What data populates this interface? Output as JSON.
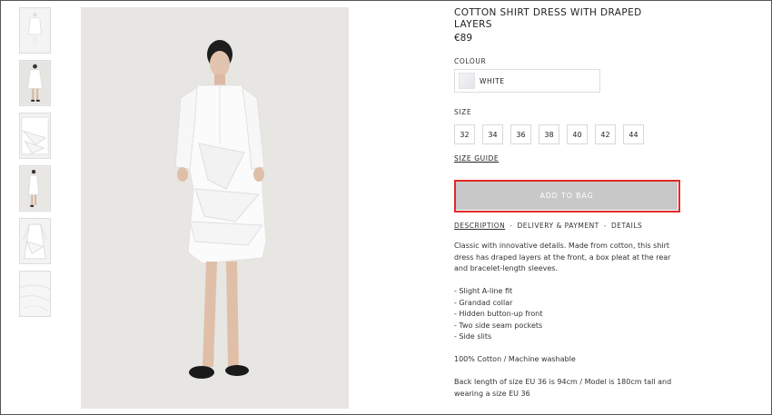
{
  "product": {
    "title": "COTTON SHIRT DRESS WITH DRAPED LAYERS",
    "price": "€89"
  },
  "colour": {
    "label": "COLOUR",
    "selected": "WHITE"
  },
  "size": {
    "label": "SIZE",
    "options": [
      "32",
      "34",
      "36",
      "38",
      "40",
      "42",
      "44"
    ],
    "guide": "SIZE GUIDE"
  },
  "cart": {
    "add_label": "ADD TO BAG"
  },
  "tabs": {
    "description": "DESCRIPTION",
    "delivery": "DELIVERY & PAYMENT",
    "details": "DETAILS",
    "separator": "-"
  },
  "description": {
    "intro": "Classic with innovative details. Made from cotton, this shirt dress has draped layers at the front, a box pleat at the rear and bracelet-length sleeves.",
    "features": [
      "- Slight A-line fit",
      "- Grandad collar",
      "- Hidden button-up front",
      "- Two side seam pockets",
      "- Side slits"
    ],
    "composition": "100% Cotton / Machine washable",
    "fit_note": "Back length of size EU 36 is 94cm / Model is 180cm tall and wearing a size EU 36"
  },
  "images": {
    "thumbnails": [
      "dress-front-thumbnail",
      "model-front-thumbnail",
      "draped-layer-detail-thumbnail",
      "model-side-thumbnail",
      "dress-flat-thumbnail",
      "fabric-detail-thumbnail"
    ],
    "main": "model-wearing-white-shirt-dress"
  },
  "colors": {
    "accent_outline": "#e12a2a",
    "button_bg": "#c8c8c8",
    "image_bg": "#e7e6e3"
  }
}
